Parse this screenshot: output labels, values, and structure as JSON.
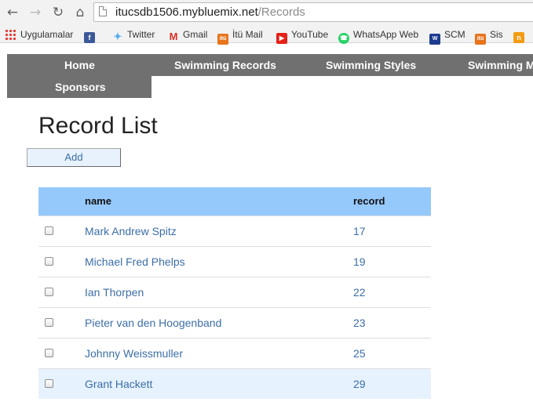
{
  "browser": {
    "url_host": "itucsdb1506.mybluemix.net",
    "url_path": "/Records",
    "bookmarks": [
      {
        "label": "Uygulamalar",
        "icon": "apps-grid-icon"
      },
      {
        "label": "",
        "icon": "facebook-icon"
      },
      {
        "label": "Twitter",
        "icon": "twitter-icon"
      },
      {
        "label": "Gmail",
        "icon": "gmail-icon"
      },
      {
        "label": "İtü Mail",
        "icon": "itu-icon"
      },
      {
        "label": "YouTube",
        "icon": "youtube-icon"
      },
      {
        "label": "WhatsApp Web",
        "icon": "whatsapp-icon"
      },
      {
        "label": "SCM",
        "icon": "scm-icon"
      },
      {
        "label": "Sis",
        "icon": "itu-icon"
      },
      {
        "label": "",
        "icon": "bookmark-icon"
      }
    ]
  },
  "nav": {
    "items": [
      "Home",
      "Swimming Records",
      "Swimming Styles",
      "Swimming M",
      "Sponsors"
    ]
  },
  "page": {
    "title": "Record List",
    "add_label": "Add"
  },
  "table": {
    "columns": [
      "name",
      "record"
    ],
    "rows": [
      {
        "name": "Mark Andrew Spitz",
        "record": "17"
      },
      {
        "name": "Michael Fred Phelps",
        "record": "19"
      },
      {
        "name": "Ian Thorpen",
        "record": "22"
      },
      {
        "name": "Pieter van den Hoogenband",
        "record": "23"
      },
      {
        "name": "Johnny Weissmuller",
        "record": "25"
      },
      {
        "name": "Grant Hackett",
        "record": "29"
      }
    ],
    "highlighted_row": 5
  },
  "colors": {
    "nav_bg": "#707070",
    "header_bg": "#96c9fb",
    "link": "#3c6ea6",
    "highlight_row": "#e6f2fd"
  }
}
